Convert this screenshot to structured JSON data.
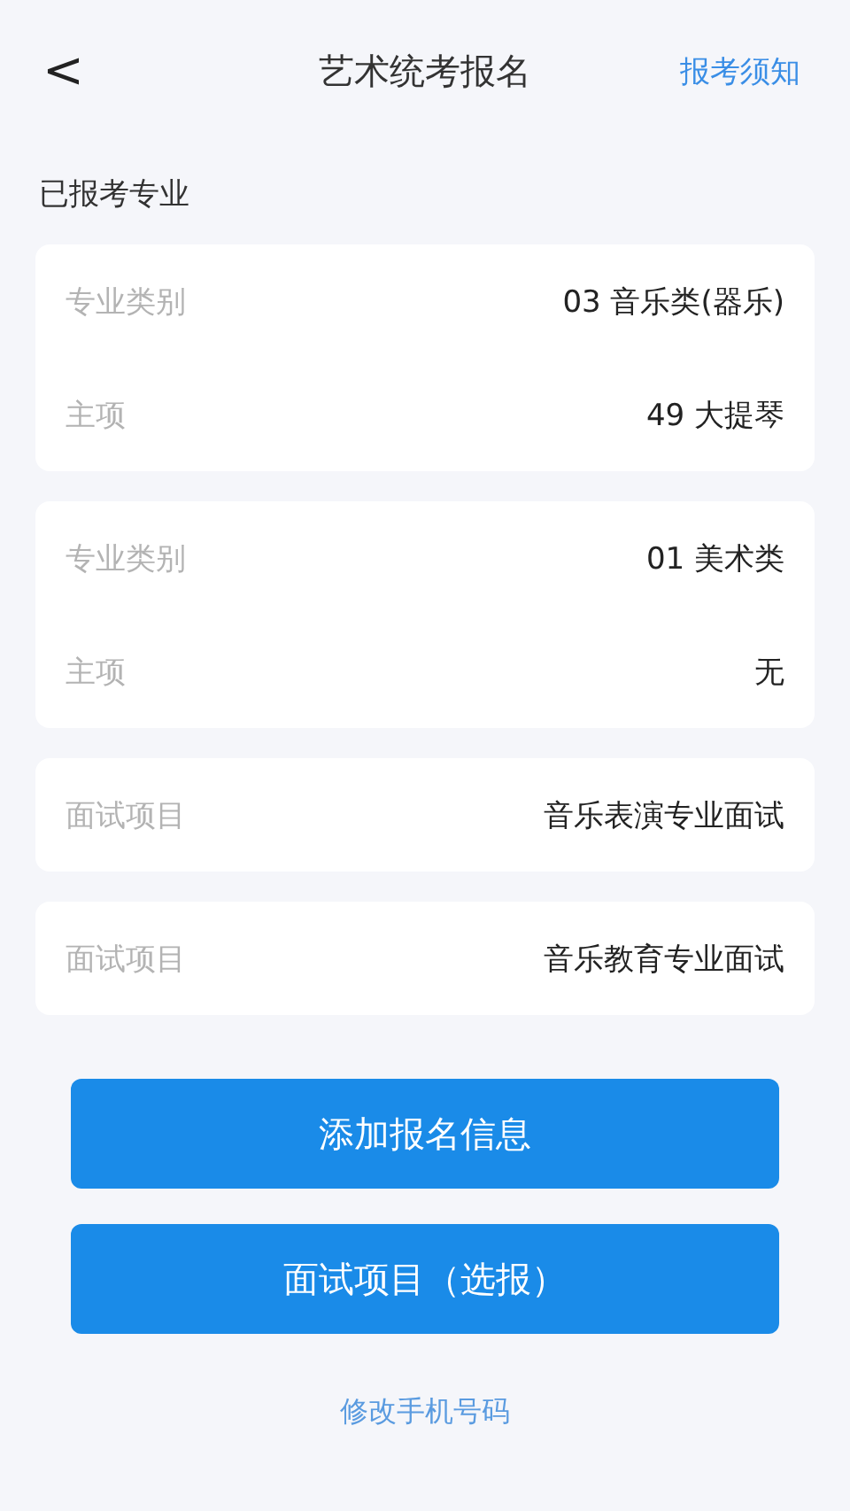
{
  "header": {
    "back": "<",
    "title": "艺术统考报名",
    "action": "报考须知"
  },
  "section_title": "已报考专业",
  "cards": [
    {
      "rows": [
        {
          "label": "专业类别",
          "value": "03 音乐类(器乐)"
        },
        {
          "label": "主项",
          "value": "49 大提琴"
        }
      ]
    },
    {
      "rows": [
        {
          "label": "专业类别",
          "value": "01 美术类"
        },
        {
          "label": "主项",
          "value": "无"
        }
      ]
    },
    {
      "rows": [
        {
          "label": "面试项目",
          "value": "音乐表演专业面试"
        }
      ]
    },
    {
      "rows": [
        {
          "label": "面试项目",
          "value": "音乐教育专业面试"
        }
      ]
    }
  ],
  "buttons": [
    "添加报名信息",
    "面试项目（选报）"
  ],
  "footer_link": "修改手机号码"
}
